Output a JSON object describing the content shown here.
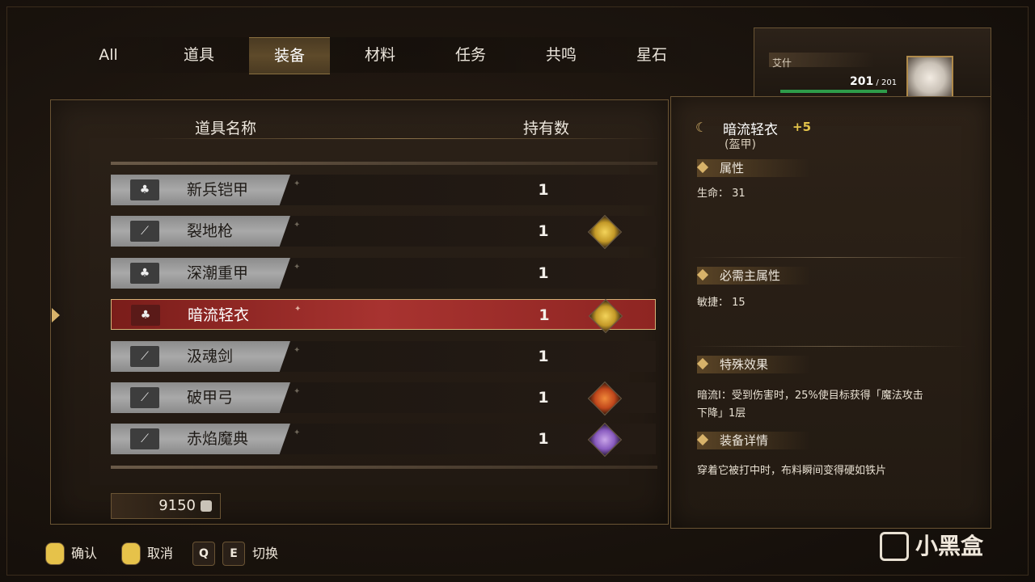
{
  "tabs": [
    "All",
    "道具",
    "装备",
    "材料",
    "任务",
    "共鸣",
    "星石"
  ],
  "active_tab_index": 2,
  "list": {
    "col_name": "道具名称",
    "col_count": "持有数",
    "items": [
      {
        "icon": "armor-icon",
        "name": "新兵铠甲",
        "count": "1",
        "equipped_avatar": null
      },
      {
        "icon": "sword-icon",
        "name": "裂地枪",
        "count": "1",
        "equipped_avatar": "blonde-character-avatar"
      },
      {
        "icon": "armor-icon",
        "name": "深潮重甲",
        "count": "1",
        "equipped_avatar": null
      },
      {
        "icon": "armor-icon",
        "name": "暗流轻衣",
        "count": "1",
        "equipped_avatar": "blonde-character-avatar"
      },
      {
        "icon": "sword-icon",
        "name": "汲魂剑",
        "count": "1",
        "equipped_avatar": null
      },
      {
        "icon": "sword-icon",
        "name": "破甲弓",
        "count": "1",
        "equipped_avatar": "orange-hair-character-avatar"
      },
      {
        "icon": "sword-icon",
        "name": "赤焰魔典",
        "count": "1",
        "equipped_avatar": "purple-hair-character-avatar"
      }
    ],
    "selected_index": 3
  },
  "money": "9150",
  "character": {
    "name": "艾什",
    "hp": "201",
    "hp_max": "201"
  },
  "detail": {
    "title": "暗流轻衣",
    "plus": "+5",
    "subtitle": "(盔甲)",
    "sections": {
      "attributes": {
        "label": "属性",
        "text": "生命： 31"
      },
      "required": {
        "label": "必需主属性",
        "text": "敏捷： 15"
      },
      "special": {
        "label": "特殊效果",
        "text_line1": "暗流Ⅰ：受到伤害时，25%使目标获得「魔法攻击",
        "text_line2": "下降」1层"
      },
      "details": {
        "label": "装备详情",
        "text": "穿着它被打中时，布料瞬间变得硬如铁片"
      }
    }
  },
  "footer": {
    "confirm": "确认",
    "cancel": "取消",
    "key_q": "Q",
    "key_e": "E",
    "switch": "切换"
  },
  "watermark": "小黑盒",
  "colors": {
    "selected_row": "#a83330",
    "accent_gold": "#d8b36a",
    "hp_bar": "#2e9c4a",
    "plus_text": "#e3c34a"
  }
}
